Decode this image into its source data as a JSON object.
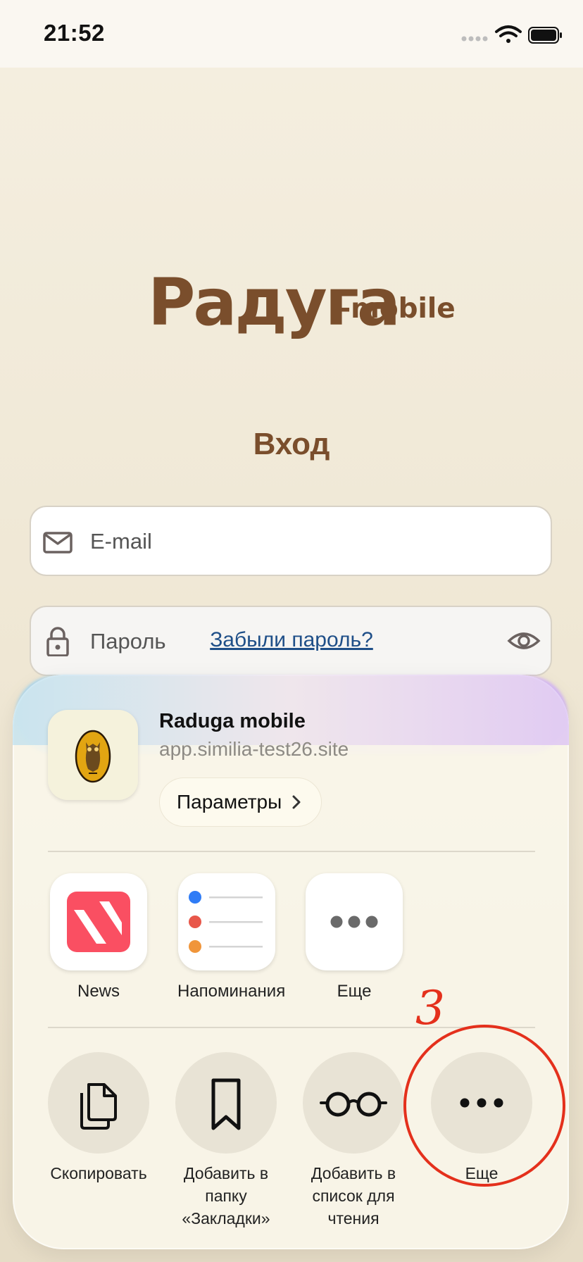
{
  "status_bar": {
    "time": "21:52"
  },
  "brand": {
    "logo_main": "Радуга",
    "logo_suffix": "-mobile",
    "accent": "#7a4e2c"
  },
  "login": {
    "title": "Вход",
    "email_placeholder": "E-mail",
    "password_placeholder": "Пароль",
    "forgot_password": "Забыли пароль?"
  },
  "share_sheet": {
    "app_name": "Raduga mobile",
    "app_url": "app.similia-test26.site",
    "params_label": "Параметры",
    "apps": [
      {
        "label": "News",
        "icon": "news-icon"
      },
      {
        "label": "Напоминания",
        "icon": "reminders-icon"
      },
      {
        "label": "Еще",
        "icon": "more-icon"
      }
    ],
    "actions": [
      {
        "label": "Скопировать",
        "icon": "copy-icon"
      },
      {
        "label": "Добавить в папку «Закладки»",
        "icon": "bookmark-icon"
      },
      {
        "label": "Добавить в список для чтения",
        "icon": "glasses-icon"
      },
      {
        "label": "Еще",
        "icon": "more-icon"
      }
    ]
  },
  "annotation": {
    "number": "3",
    "color": "#e4301c"
  }
}
